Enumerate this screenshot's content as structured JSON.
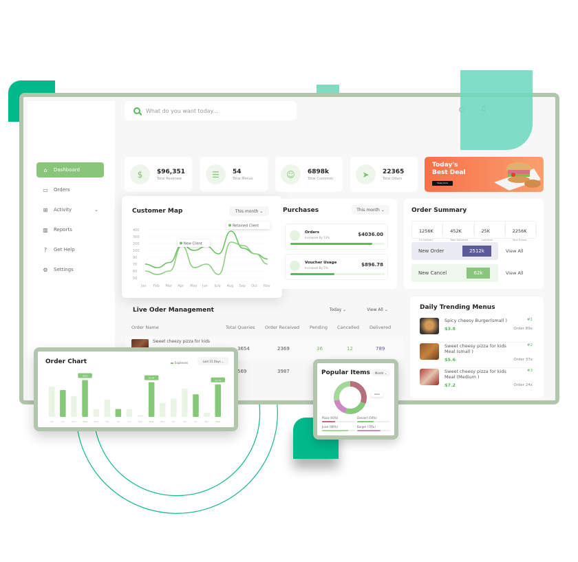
{
  "search": {
    "placeholder": "What do you want today..."
  },
  "header_icons": [
    "search-icon",
    "bell-icon"
  ],
  "sidebar": {
    "items": [
      {
        "label": "Dashboard",
        "icon": "home-icon",
        "active": true
      },
      {
        "label": "Orders",
        "icon": "orders-icon"
      },
      {
        "label": "Activity",
        "icon": "activity-icon",
        "has_chevron": true
      },
      {
        "label": "Reports",
        "icon": "reports-icon"
      },
      {
        "label": "Get Help",
        "icon": "help-icon"
      },
      {
        "label": "Settings",
        "icon": "settings-icon"
      }
    ]
  },
  "stats": [
    {
      "value": "$96,351",
      "label": "Total Revenew",
      "icon": "dollar-icon"
    },
    {
      "value": "54",
      "label": "Total Menus",
      "icon": "menu-icon"
    },
    {
      "value": "6898k",
      "label": "Total Customer",
      "icon": "customers-icon"
    },
    {
      "value": "22365",
      "label": "Total Odars",
      "icon": "send-icon"
    }
  ],
  "banner": {
    "title_line1": "Today's",
    "title_line2": "Best Deal",
    "button": "View more"
  },
  "customer_map": {
    "title": "Customer Map",
    "filter": "This month",
    "tooltip_new": "New Client",
    "tooltip_retained": "Retained Client"
  },
  "chart_data": [
    {
      "type": "line",
      "title": "Customer Map",
      "x": [
        "Jan",
        "Feb",
        "Mar",
        "Apr",
        "May",
        "Jun",
        "July",
        "Aug",
        "Sep",
        "Oct",
        "Nov"
      ],
      "y_ticks": [
        "400",
        "300",
        "200",
        "100",
        "90",
        "70",
        "60",
        "50"
      ],
      "series": [
        {
          "name": "New Client",
          "values": [
            70,
            65,
            75,
            180,
            100,
            160,
            95,
            380,
            130,
            95,
            85
          ]
        },
        {
          "name": "Retained Client",
          "values": [
            60,
            55,
            60,
            170,
            65,
            70,
            55,
            220,
            170,
            95,
            70
          ]
        }
      ],
      "legend": "tooltip"
    },
    {
      "type": "bar",
      "title": "Order Chart",
      "legend": [
        "Expenses"
      ],
      "categories": [
        "Sat",
        "Sun",
        "Mon",
        "Tues",
        "Wed",
        "Thu",
        "Sat",
        "Sun",
        "Mon",
        "Tues",
        "Wed",
        "Thu",
        "Sat",
        "Sun",
        "Mon",
        "Tues"
      ],
      "values": [
        70,
        62,
        48,
        85,
        18,
        40,
        18,
        18,
        4,
        80,
        32,
        42,
        65,
        52,
        10,
        75
      ],
      "highlighted": [
        false,
        true,
        false,
        true,
        false,
        false,
        true,
        false,
        false,
        true,
        false,
        false,
        false,
        true,
        false,
        true
      ],
      "labels": {
        "3": "$826",
        "9": "$2.44",
        "15": "$2.34"
      }
    },
    {
      "type": "pie",
      "title": "Popular Items",
      "categories": [
        "Pizza",
        "Dessert",
        "Juice",
        "Burger"
      ],
      "values": [
        40,
        50,
        80,
        70
      ],
      "colors": [
        "#b4707c",
        "#86c97a",
        "#a4d89a",
        "#cc88c0"
      ]
    }
  ],
  "order_chart": {
    "title": "Order Chart",
    "legend": "Expenses",
    "filter": "Last 15 Days"
  },
  "purchases": {
    "title": "Purchases",
    "filter": "This month",
    "items": [
      {
        "name": "Orders",
        "sub": "Increased By 13%",
        "amount": "$4036.00",
        "progress": 0.87
      },
      {
        "name": "Voucher Usage",
        "sub": "Increased By 5%",
        "amount": "$896.78",
        "progress": 0.47
      }
    ]
  },
  "order_summary": {
    "title": "Order Summary",
    "stats": [
      {
        "value": "1256K",
        "label": "On Delivery"
      },
      {
        "value": "452K",
        "label": "Total Delivered"
      },
      {
        "value": "25K",
        "label": "Canceled"
      },
      {
        "value": "2256K",
        "label": "Total Prases"
      }
    ],
    "new_order": {
      "label": "New Order",
      "value": "2512k",
      "link": "View All"
    },
    "new_cancel": {
      "label": "New Cancel",
      "value": "62k",
      "link": "View All"
    }
  },
  "live": {
    "title": "Live Oder Management",
    "filter1": "Today",
    "filter2": "View All",
    "columns": [
      "Order Name",
      "Total Queries",
      "Order Received",
      "Pending",
      "Cancelled",
      "Delivered"
    ],
    "rows": [
      {
        "name": "Sweet cheezy pizza for kids",
        "queries": "3654",
        "received": "2369",
        "pending": "36",
        "cancelled": "12",
        "delivered": "789"
      },
      {
        "name": "",
        "queries": "569",
        "received": "3987",
        "pending": "",
        "cancelled": "",
        "delivered": ""
      }
    ]
  },
  "daily": {
    "title": "Daily Trending Menus",
    "items": [
      {
        "name": "Spicy cheesy Burger(small )",
        "price": "$3.8",
        "rank": "#1",
        "orders": "Order 89x"
      },
      {
        "name": "Sweet cheesy pizza for kids Meal (small )",
        "price": "$5.6",
        "rank": "#2",
        "orders": "Order 37x"
      },
      {
        "name": "Sweet cheesy pizza for kids Meal (Medium )",
        "price": "$7.2",
        "rank": "#3",
        "orders": "Order 24x"
      }
    ]
  },
  "popular": {
    "title": "Popular Items",
    "filter": "Month",
    "tooltip": "Pizza",
    "legend": [
      {
        "label": "Pizza (40%)",
        "pct": 0.4,
        "color": "#b4707c"
      },
      {
        "label": "Dessert (50%)",
        "pct": 0.5,
        "color": "#86c97a"
      },
      {
        "label": "Juice (80%)",
        "pct": 0.8,
        "color": "#a4d89a"
      },
      {
        "label": "Burger (70%)",
        "pct": 0.7,
        "color": "#cc88c0"
      }
    ]
  },
  "colors": {
    "accent": "#8ac57c",
    "frame": "#b2c5ad",
    "teal": "#00b98a",
    "purple": "#5b5b99",
    "orange": "#f87048"
  }
}
